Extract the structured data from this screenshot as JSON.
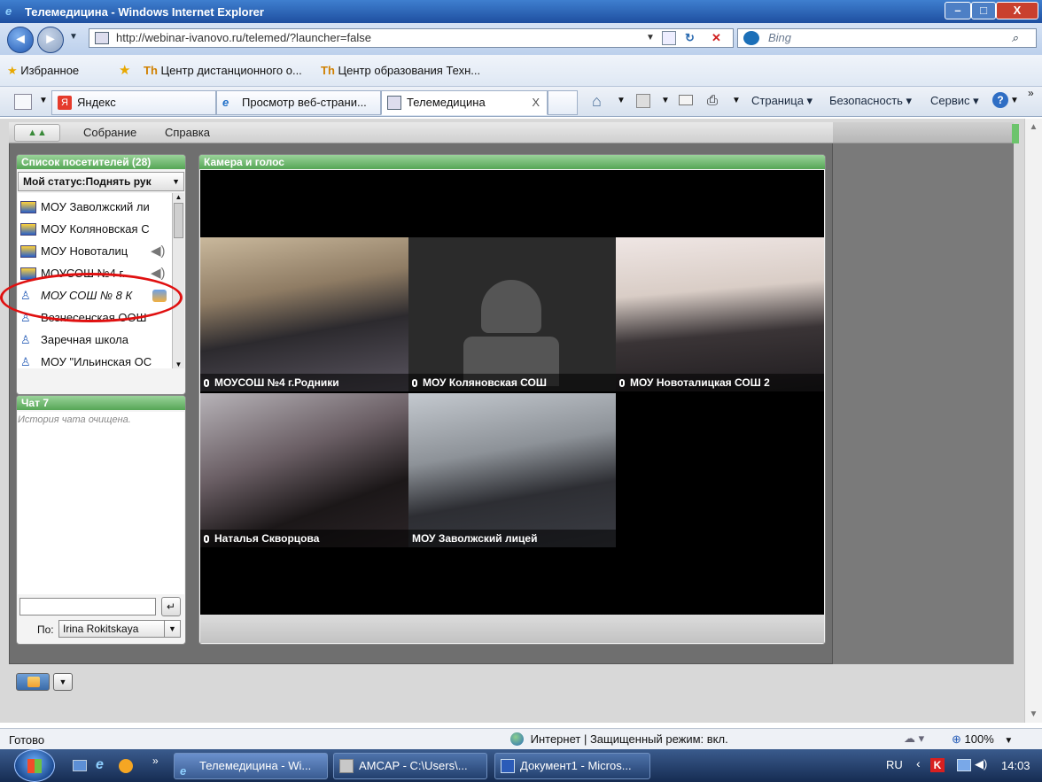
{
  "window": {
    "title": "Телемедицина - Windows Internet Explorer",
    "min": "–",
    "max": "□",
    "close": "X"
  },
  "address": {
    "url": "http://webinar-ivanovo.ru/telemed/?launcher=false",
    "search_placeholder": "Bing"
  },
  "favorites": {
    "label": "Избранное",
    "items": [
      "Центр дистанционного о...",
      "Центр образования Техн..."
    ]
  },
  "tabs": {
    "yandex": "Яндекс",
    "view": "Просмотр веб-страни...",
    "active": "Телемедицина",
    "close": "X"
  },
  "commands": {
    "page": "Страница ▾",
    "security": "Безопасность ▾",
    "service": "Сервис ▾",
    "help": "?"
  },
  "app": {
    "menu": {
      "meeting": "Собрание",
      "help": "Справка"
    },
    "attendees": {
      "title": "Список посетителей (28)",
      "status": "Мой статус:Поднять рук",
      "items": [
        "МОУ Заволжский ли",
        "МОУ Коляновская С",
        "МОУ Новоталиц",
        "МОУСОШ №4 г.",
        "МОУ СОШ № 8 К",
        "Вознесенская ООШ",
        "Заречная школа",
        "МОУ \"Ильинская ОС"
      ]
    },
    "camera": {
      "title": "Камера и голос",
      "tiles": [
        "МОУСОШ №4 г.Родники",
        "МОУ Коляновская СОШ",
        "МОУ Новоталицкая СОШ 2",
        "Наталья Скворцова",
        "МОУ Заволжский лицей"
      ]
    },
    "chat": {
      "title": "Чат 7",
      "history": "История чата очищена.",
      "to_label": "По:",
      "to_value": "Irina Rokitskaya"
    }
  },
  "status": {
    "ready": "Готово",
    "zone": "Интернет | Защищенный режим: вкл.",
    "zoom": "100%"
  },
  "taskbar": {
    "items": [
      "Телемедицина - Wi...",
      "AMCAP - C:\\Users\\...",
      "Документ1 - Micros..."
    ],
    "lang": "RU",
    "clock": "14:03"
  },
  "colors": {
    "panel_header": "#56a656",
    "highlight_circle": "#e01010"
  }
}
